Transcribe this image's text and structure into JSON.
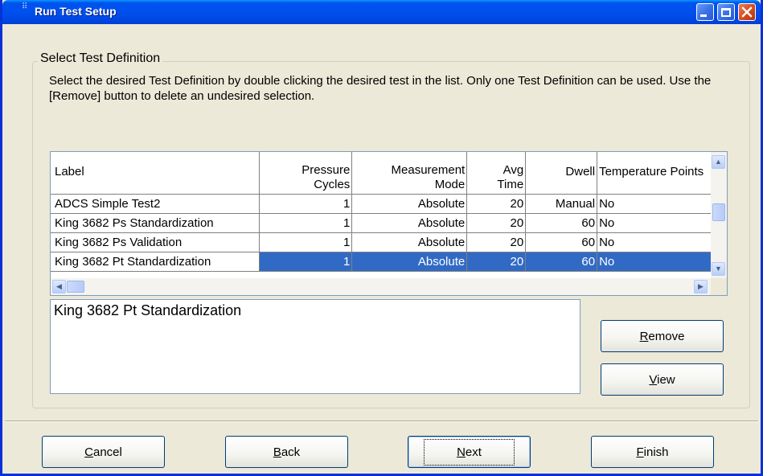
{
  "window": {
    "title": "Run Test Setup"
  },
  "group": {
    "title": "Select Test Definition",
    "instructions": "Select the desired Test Definition by double clicking the desired test in the list.  Only one Test Definition can be used.  Use the [Remove] button to delete an undesired selection."
  },
  "grid": {
    "columns": [
      {
        "label": "Label"
      },
      {
        "label": "Pressure Cycles"
      },
      {
        "label": "Measurement Mode"
      },
      {
        "label": "Avg Time"
      },
      {
        "label": "Dwell"
      },
      {
        "label": "Temperature Points"
      }
    ],
    "rows": [
      {
        "label": "ADCS Simple Test2",
        "cycles": "1",
        "mode": "Absolute",
        "avg": "20",
        "dwell": "Manual",
        "temp": "No"
      },
      {
        "label": "King 3682 Ps Standardization",
        "cycles": "1",
        "mode": "Absolute",
        "avg": "20",
        "dwell": "60",
        "temp": "No"
      },
      {
        "label": "King 3682 Ps Validation",
        "cycles": "1",
        "mode": "Absolute",
        "avg": "20",
        "dwell": "60",
        "temp": "No"
      },
      {
        "label": "King 3682 Pt Standardization",
        "cycles": "1",
        "mode": "Absolute",
        "avg": "20",
        "dwell": "60",
        "temp": "No"
      }
    ],
    "selected_row": 3
  },
  "selection_text": "King 3682 Pt Standardization",
  "buttons": {
    "remove": {
      "prefix": "",
      "accel": "R",
      "rest": "emove"
    },
    "view": {
      "prefix": "",
      "accel": "V",
      "rest": "iew"
    },
    "cancel": {
      "prefix": "",
      "accel": "C",
      "rest": "ancel"
    },
    "back": {
      "prefix": "",
      "accel": "B",
      "rest": "ack"
    },
    "next": {
      "prefix": "",
      "accel": "N",
      "rest": "ext"
    },
    "finish": {
      "prefix": "",
      "accel": "F",
      "rest": "inish"
    }
  },
  "colors": {
    "titlebar": "#0054E3",
    "selection": "#316AC5",
    "dialog_bg": "#ECE9D8"
  }
}
